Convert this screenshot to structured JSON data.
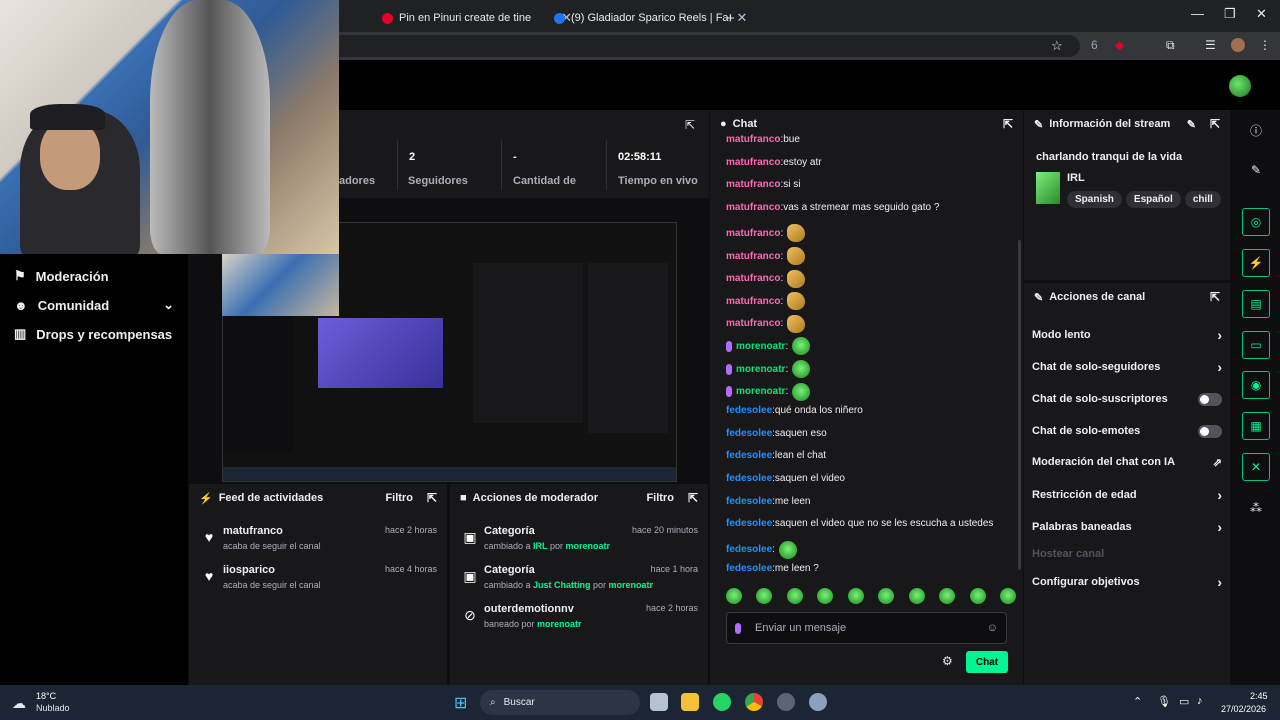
{
  "browser": {
    "tabs": [
      {
        "label": "Pin en Pinuri create de tine"
      },
      {
        "label": "(9) Gladiador Sparico Reels | Fa"
      }
    ],
    "new_tab": "+",
    "profile_badge": "6"
  },
  "sidebar": {
    "items": [
      {
        "label": "Moderación",
        "icon": "shield-icon"
      },
      {
        "label": "Comunidad",
        "icon": "people-icon"
      },
      {
        "label": "Drops y recompensas",
        "icon": "chart-icon"
      }
    ]
  },
  "stats": {
    "items": [
      {
        "value": "",
        "label": "adores"
      },
      {
        "value": "2",
        "label": "Seguidores"
      },
      {
        "value": "-",
        "label": "Cantidad de"
      },
      {
        "value": "02:58:11",
        "label": "Tiempo en vivo"
      }
    ]
  },
  "activity_feed": {
    "title": "Feed de actividades",
    "filter": "Filtro",
    "items": [
      {
        "name": "matufranco",
        "sub": "acaba de seguir el canal",
        "time": "hace 2 horas"
      },
      {
        "name": "iiosparico",
        "sub": "acaba de seguir el canal",
        "time": "hace 4 horas"
      }
    ]
  },
  "mod_actions": {
    "title": "Acciones de moderador",
    "filter": "Filtro",
    "items": [
      {
        "name": "Categoría",
        "pre": "cambiado a ",
        "value": "IRL",
        "mid": " por ",
        "by": "morenoatr",
        "time": "hace 20 minutos"
      },
      {
        "name": "Categoría",
        "pre": "cambiado a ",
        "value": "Just Chatting",
        "mid": " por ",
        "by": "morenoatr",
        "time": "hace 1 hora"
      },
      {
        "name": "outerdemotionnv",
        "pre": "baneado por ",
        "value": "",
        "mid": "",
        "by": "morenoatr",
        "time": "hace 2 horas"
      }
    ]
  },
  "chat": {
    "title": "Chat",
    "messages": [
      {
        "user": "matufranco",
        "text": "bue",
        "color": "pink"
      },
      {
        "user": "matufranco",
        "text": "estoy atr",
        "color": "pink"
      },
      {
        "user": "matufranco",
        "text": "si si",
        "color": "pink"
      },
      {
        "user": "matufranco",
        "text": "vas a stremear mas seguido gato ?",
        "color": "pink"
      },
      {
        "user": "matufranco",
        "text": "",
        "color": "pink",
        "emote": "wave"
      },
      {
        "user": "matufranco",
        "text": "",
        "color": "pink",
        "emote": "wave"
      },
      {
        "user": "matufranco",
        "text": "",
        "color": "pink",
        "emote": "wave"
      },
      {
        "user": "matufranco",
        "text": "",
        "color": "pink",
        "emote": "wave"
      },
      {
        "user": "matufranco",
        "text": "",
        "color": "pink",
        "emote": "wave"
      },
      {
        "user": "morenoatr",
        "text": "",
        "color": "green",
        "emote": "frog",
        "mic": true
      },
      {
        "user": "morenoatr",
        "text": "",
        "color": "green",
        "emote": "frog",
        "mic": true
      },
      {
        "user": "morenoatr",
        "text": "",
        "color": "green",
        "emote": "frog",
        "mic": true
      },
      {
        "user": "fedesolee",
        "text": "qué onda los niñero",
        "color": "blue"
      },
      {
        "user": "fedesolee",
        "text": "saquen eso",
        "color": "blue"
      },
      {
        "user": "fedesolee",
        "text": "lean el chat",
        "color": "blue"
      },
      {
        "user": "fedesolee",
        "text": "saquen el video",
        "color": "blue"
      },
      {
        "user": "fedesolee",
        "text": "me leen",
        "color": "blue"
      },
      {
        "user": "fedesolee",
        "text": "saquen el video que no se les escucha a ustedes",
        "color": "blue"
      },
      {
        "user": "fedesolee",
        "text": "",
        "color": "blue",
        "emote": "frog"
      },
      {
        "user": "fedesolee",
        "text": "me leen ?",
        "color": "blue"
      }
    ],
    "placeholder": "Enviar un mensaje",
    "send": "Chat"
  },
  "stream_info": {
    "title": "Información del stream",
    "stream_title": "charlando tranqui de la vida",
    "category": "IRL",
    "tags": [
      "Spanish",
      "Español",
      "chill"
    ]
  },
  "channel_actions": {
    "title": "Acciones de canal",
    "items": [
      {
        "label": "Modo lento",
        "control": "chevron"
      },
      {
        "label": "Chat de solo-seguidores",
        "control": "chevron"
      },
      {
        "label": "Chat de solo-suscriptores",
        "control": "toggle"
      },
      {
        "label": "Chat de solo-emotes",
        "control": "toggle"
      },
      {
        "label": "Moderación del chat con IA",
        "control": "external"
      },
      {
        "label": "Restricción de edad",
        "control": "chevron"
      },
      {
        "label": "Palabras baneadas",
        "control": "chevron"
      },
      {
        "label": "Hostear canal",
        "control": "none",
        "disabled": true
      },
      {
        "label": "Configurar objetivos",
        "control": "chevron"
      }
    ]
  },
  "taskbar": {
    "weather_temp": "18°C",
    "weather_desc": "Nublado",
    "search": "Buscar",
    "time": "2:45",
    "date": "27/02/2026"
  },
  "colors": {
    "accent": "#00f593",
    "panel": "#18181b",
    "background": "#0e0e10"
  }
}
